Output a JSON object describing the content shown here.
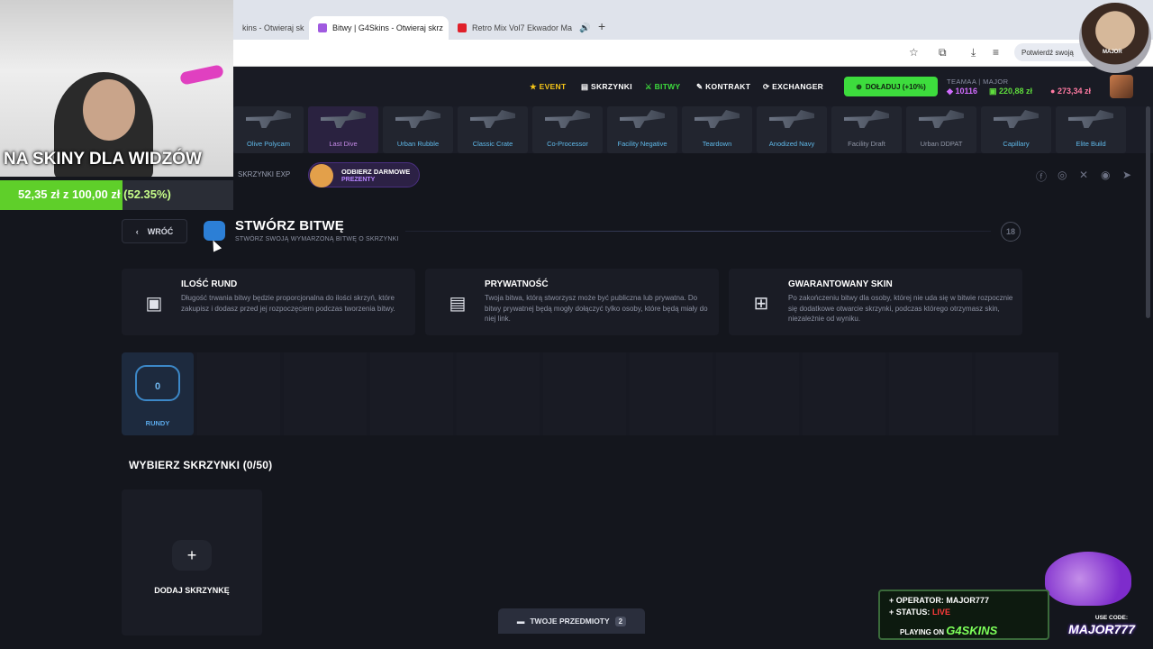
{
  "browser": {
    "tabs": [
      {
        "title": "kins - Otwieraj sk",
        "active": false
      },
      {
        "title": "Bitwy | G4Skins - Otwieraj skrz",
        "active": true
      },
      {
        "title": "Retro Mix Vol7 Ekwador Ma",
        "active": false
      }
    ],
    "confirm_label": "Potwierdź swoją"
  },
  "header": {
    "nav": [
      {
        "label": "EVENT",
        "icon": "star-icon",
        "color": "#f5c518"
      },
      {
        "label": "SKRZYNKI",
        "icon": "case-icon",
        "color": "#ffffff"
      },
      {
        "label": "BITWY",
        "icon": "swords-icon",
        "color": "#3ddc3d"
      },
      {
        "label": "KONTRAKT",
        "icon": "pen-icon",
        "color": "#ffffff"
      },
      {
        "label": "EXCHANGER",
        "icon": "exchange-icon",
        "color": "#ffffff"
      }
    ],
    "topup_label": "DOŁADUJ (+10%)",
    "user_name": "TEAMAA | MAJOR",
    "stats": {
      "gems": "10116",
      "balance": "220,88 zł",
      "coins": "273,34 zł"
    }
  },
  "cases": [
    {
      "name": "Olive Polycam",
      "style": "blue"
    },
    {
      "name": "Last Dive",
      "style": "purple"
    },
    {
      "name": "Urban Rubble",
      "style": "blue"
    },
    {
      "name": "Classic Crate",
      "style": "blue"
    },
    {
      "name": "Co-Processor",
      "style": "blue"
    },
    {
      "name": "Facility Negative",
      "style": "blue"
    },
    {
      "name": "Teardown",
      "style": "blue"
    },
    {
      "name": "Anodized Navy",
      "style": "blue"
    },
    {
      "name": "Facility Draft",
      "style": "grey"
    },
    {
      "name": "Urban DDPAT",
      "style": "grey"
    },
    {
      "name": "Capillary",
      "style": "blue"
    },
    {
      "name": "Elite Build",
      "style": "blue"
    }
  ],
  "stream": {
    "title": "NA SKINY DLA WIDZÓW",
    "goal_current": "52,35 zł",
    "goal_sep": "z",
    "goal_target": "100,00 zł",
    "goal_percent": "(52.35%)",
    "goal_fraction": 0.5235,
    "operator": "+ OPERATOR: MAJOR777",
    "status_label": "+ STATUS:",
    "status_value": "LIVE",
    "playing_on": "PLAYING ON",
    "playing_site": "G4SKINS",
    "use_code": "USE CODE:",
    "code": "MAJOR777",
    "avatar_tag": "MAJOR"
  },
  "subnav": {
    "exp_label": "SKRZYNKI EXP",
    "freebie_line1": "ODBIERZ DARMOWE",
    "freebie_line2": "PREZENTY"
  },
  "page": {
    "back_label": "WRÓĆ",
    "title": "STWÓRZ BITWĘ",
    "subtitle": "STWÓRZ SWOJĄ WYMARZONĄ BITWĘ O SKRZYNKI",
    "age_badge": "18"
  },
  "info_cards": [
    {
      "title": "ILOŚĆ RUND",
      "icon": "case-icon",
      "desc": "Długość trwania bitwy będzie proporcjonalna do ilości skrzyń, które zakupisz i dodasz przed jej rozpoczęciem podczas tworzenia bitwy."
    },
    {
      "title": "PRYWATNOŚĆ",
      "icon": "document-icon",
      "desc": "Twoja bitwa, którą stworzysz może być publiczna lub prywatna. Do bitwy prywatnej będą mogły dołączyć tylko osoby, które będą miały do niej link."
    },
    {
      "title": "GWARANTOWANY SKIN",
      "icon": "gift-icon",
      "desc": "Po zakończeniu bitwy dla osoby, której nie uda się w bitwie rozpocznie się dodatkowe otwarcie skrzynki, podczas którego otrzymasz skin, niezależnie od wyniku."
    }
  ],
  "rounds": {
    "count": "0",
    "label": "RUNDY"
  },
  "select_cases": {
    "title": "WYBIERZ SKRZYNKI (0/50)",
    "add_label": "DODAJ SKRZYNKĘ"
  },
  "items_button": {
    "label": "TWOJE PRZEDMIOTY",
    "count": "2"
  }
}
